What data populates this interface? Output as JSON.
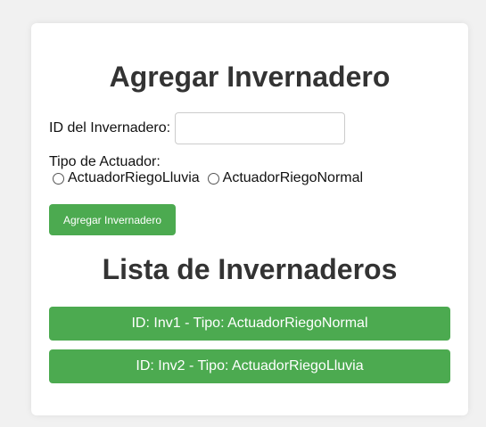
{
  "form": {
    "title": "Agregar Invernadero",
    "id_label": "ID del Invernadero:",
    "id_value": "",
    "tipo_label": "Tipo de Actuador:",
    "options": [
      {
        "label": "ActuadorRiegoLluvia",
        "selected": false
      },
      {
        "label": "ActuadorRiegoNormal",
        "selected": false
      }
    ],
    "submit_label": "Agregar Invernadero"
  },
  "list": {
    "title": "Lista de Invernaderos",
    "items": [
      {
        "label": "ID: Inv1 - Tipo: ActuadorRiegoNormal"
      },
      {
        "label": "ID: Inv2 - Tipo: ActuadorRiegoLluvia"
      }
    ]
  },
  "colors": {
    "accent": "#4caa50",
    "background": "#f1f1f1",
    "card": "#ffffff",
    "heading": "#333333"
  }
}
